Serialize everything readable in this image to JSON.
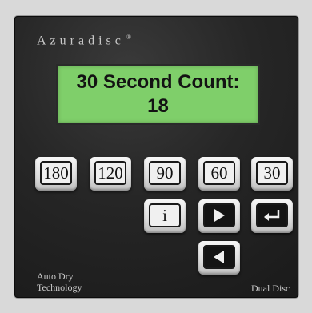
{
  "brand": {
    "name": "Azuradisc",
    "mark": "®"
  },
  "display": {
    "line1": "30 Second Count:",
    "line2": "18",
    "background": "#7fcf6a"
  },
  "keys": {
    "k180": "180",
    "k120": "120",
    "k90": "90",
    "k60": "60",
    "k30": "30",
    "info": "i",
    "play": {
      "icon": "play-icon"
    },
    "enter": {
      "icon": "enter-icon"
    },
    "back": {
      "icon": "back-icon"
    }
  },
  "footer": {
    "left_line1": "Auto Dry",
    "left_line2": "Technology",
    "right": "Dual Disc"
  }
}
